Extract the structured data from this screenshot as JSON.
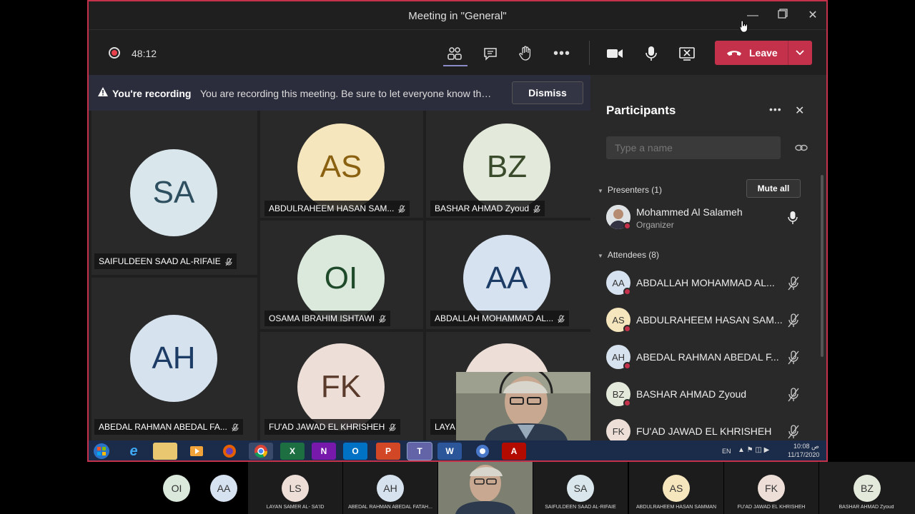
{
  "window": {
    "title": "Meeting in \"General\""
  },
  "toolbar": {
    "timer": "48:12",
    "leave_label": "Leave"
  },
  "banner": {
    "title": "You're recording",
    "message": "You are recording this meeting. Be sure to let everyone know that they are being recorded.",
    "dismiss_label": "Dismiss"
  },
  "stage": {
    "tiles": [
      {
        "initials": "SA",
        "name": "SAIFULDEEN SAAD AL-RIFAIE",
        "color": "#d9e6ec",
        "text_color": "#2e4f5f"
      },
      {
        "initials": "AS",
        "name": "ABDULRAHEEM HASAN SAM...",
        "color": "#f6e6bd",
        "text_color": "#8a6110"
      },
      {
        "initials": "BZ",
        "name": "BASHAR AHMAD Zyoud",
        "color": "#e4eadb",
        "text_color": "#394b2b"
      },
      {
        "initials": "OI",
        "name": "OSAMA IBRAHIM ISHTAWI",
        "color": "#dae9dc",
        "text_color": "#1e4a2a"
      },
      {
        "initials": "AA",
        "name": "ABDALLAH MOHAMMAD AL...",
        "color": "#d6e2f0",
        "text_color": "#1c3c66"
      },
      {
        "initials": "AH",
        "name": "ABEDAL RAHMAN ABEDAL FA...",
        "color": "#d6e2ee",
        "text_color": "#1c3c66"
      },
      {
        "initials": "FK",
        "name": "FU'AD JAWAD EL KHRISHEH",
        "color": "#eddfd8",
        "text_color": "#5a3a2a"
      },
      {
        "initials": "",
        "name": "LAYAI",
        "color": "#eddfd8",
        "text_color": "#5a3a2a"
      }
    ]
  },
  "participants": {
    "title": "Participants",
    "search_placeholder": "Type a name",
    "presenters_label": "Presenters (1)",
    "mute_all_label": "Mute all",
    "presenter": {
      "name": "Mohammed Al Salameh",
      "role": "Organizer"
    },
    "attendees_label": "Attendees (8)",
    "attendees": [
      {
        "initials": "AA",
        "name": "ABDALLAH MOHAMMAD AL...",
        "color": "#d6e2f0"
      },
      {
        "initials": "AS",
        "name": "ABDULRAHEEM HASAN SAM...",
        "color": "#f6e6bd"
      },
      {
        "initials": "AH",
        "name": "ABEDAL RAHMAN ABEDAL F...",
        "color": "#d6e2ee"
      },
      {
        "initials": "BZ",
        "name": "BASHAR AHMAD Zyoud",
        "color": "#e4eadb"
      },
      {
        "initials": "FK",
        "name": "FU'AD JAWAD EL KHRISHEH",
        "color": "#eddfd8"
      }
    ]
  },
  "taskbar": {
    "lang": "EN",
    "time": "10:08",
    "ampm": "ص",
    "date": "11/17/2020",
    "apps": [
      "start",
      "ie",
      "explorer",
      "media",
      "firefox",
      "chrome",
      "excel",
      "onenote",
      "outlook",
      "powerpoint",
      "teams",
      "word",
      "chrome2",
      "acrobat"
    ]
  },
  "strip": {
    "tiles": [
      {
        "initials": "OI",
        "name": "",
        "color": "#dae9dc"
      },
      {
        "initials": "AA",
        "name": "",
        "color": "#d6e2f0"
      },
      {
        "initials": "LS",
        "name": "LAYAN SAMER AL- SA'ID",
        "color": "#eddfd8"
      },
      {
        "initials": "AH",
        "name": "ABEDAL RAHMAN ABEDAL FATAH...",
        "color": "#d6e2ee"
      },
      {
        "initials": "",
        "name": "",
        "color": "#6f6e63"
      },
      {
        "initials": "SA",
        "name": "SAIFULDEEN SAAD AL-RIFAIE",
        "color": "#d9e6ec"
      },
      {
        "initials": "AS",
        "name": "ABDULRAHEEM HASAN SAMMAN",
        "color": "#f6e6bd"
      },
      {
        "initials": "FK",
        "name": "FU'AD JAWAD EL KHRISHEH",
        "color": "#eddfd8"
      },
      {
        "initials": "BZ",
        "name": "BASHAR AHMAD Zyoud",
        "color": "#e4eadb"
      }
    ]
  }
}
